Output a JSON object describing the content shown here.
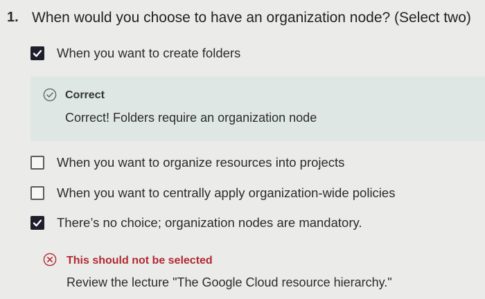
{
  "question": {
    "number": "1.",
    "text": "When would you choose to have an organization node? (Select two)"
  },
  "options": [
    {
      "label": "When you want to create folders",
      "checked": true
    },
    {
      "label": "When you want to organize resources into projects",
      "checked": false
    },
    {
      "label": "When you want to centrally apply organization-wide policies",
      "checked": false
    },
    {
      "label": "There’s no choice; organization nodes are mandatory.",
      "checked": true
    }
  ],
  "feedback_correct": {
    "title": "Correct",
    "body": "Correct! Folders require an organization node",
    "color": "#4a5a55",
    "icon": "check-circle-icon"
  },
  "feedback_incorrect": {
    "title": "This should not be selected",
    "body": "Review the lecture \"The Google Cloud resource hierarchy.\"",
    "color": "#b2282f",
    "icon": "x-circle-icon"
  }
}
